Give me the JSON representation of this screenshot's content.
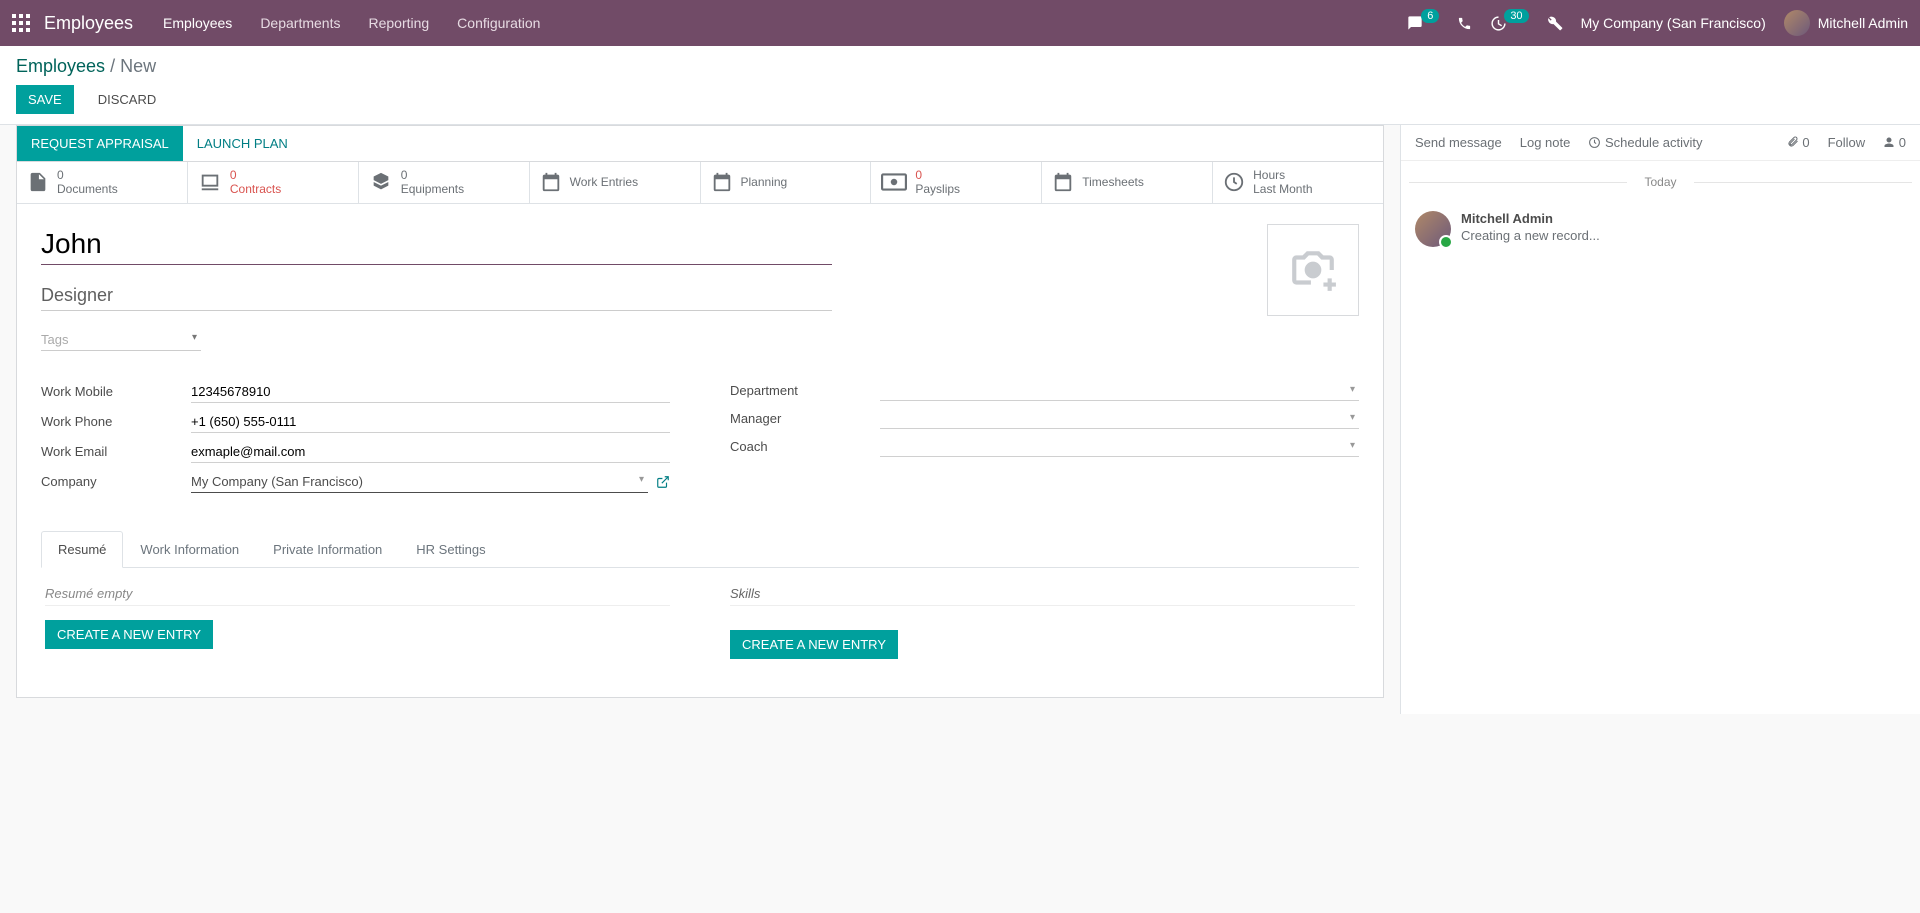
{
  "navbar": {
    "brand": "Employees",
    "menu": [
      "Employees",
      "Departments",
      "Reporting",
      "Configuration"
    ],
    "chat_badge": "6",
    "clock_badge": "30",
    "company": "My Company (San Francisco)",
    "user": "Mitchell Admin"
  },
  "breadcrumb": {
    "root": "Employees",
    "current": "New"
  },
  "actions": {
    "save": "Save",
    "discard": "Discard"
  },
  "statusbar": {
    "request_appraisal": "Request Appraisal",
    "launch_plan": "Launch Plan"
  },
  "stats": [
    {
      "count": "0",
      "label": "Documents",
      "icon": "file"
    },
    {
      "count": "0",
      "label": "Contracts",
      "icon": "book",
      "warn": true
    },
    {
      "count": "0",
      "label": "Equipments",
      "icon": "cubes"
    },
    {
      "count": "",
      "label": "Work Entries",
      "icon": "calendar"
    },
    {
      "count": "",
      "label": "Planning",
      "icon": "calendar2"
    },
    {
      "count": "0",
      "label": "Payslips",
      "icon": "money"
    },
    {
      "count": "",
      "label": "Timesheets",
      "icon": "calendar3"
    },
    {
      "count": "Hours",
      "label": "Last Month",
      "icon": "clock"
    }
  ],
  "form": {
    "name": "John",
    "job_title": "Designer",
    "tags_placeholder": "Tags",
    "left": {
      "work_mobile_label": "Work Mobile",
      "work_mobile": "12345678910",
      "work_phone_label": "Work Phone",
      "work_phone": "+1 (650) 555-0111",
      "work_email_label": "Work Email",
      "work_email": "exmaple@mail.com",
      "company_label": "Company",
      "company": "My Company (San Francisco)"
    },
    "right": {
      "department_label": "Department",
      "department": "",
      "manager_label": "Manager",
      "manager": "",
      "coach_label": "Coach",
      "coach": ""
    }
  },
  "tabs": {
    "items": [
      "Resumé",
      "Work Information",
      "Private Information",
      "HR Settings"
    ],
    "resume_empty": "Resumé empty",
    "skills_title": "Skills",
    "create_entry": "Create a new entry"
  },
  "chatter": {
    "send": "Send message",
    "log": "Log note",
    "schedule": "Schedule activity",
    "attach_count": "0",
    "follow": "Follow",
    "follower_count": "0",
    "today": "Today",
    "msg_author": "Mitchell Admin",
    "msg_text": "Creating a new record..."
  }
}
